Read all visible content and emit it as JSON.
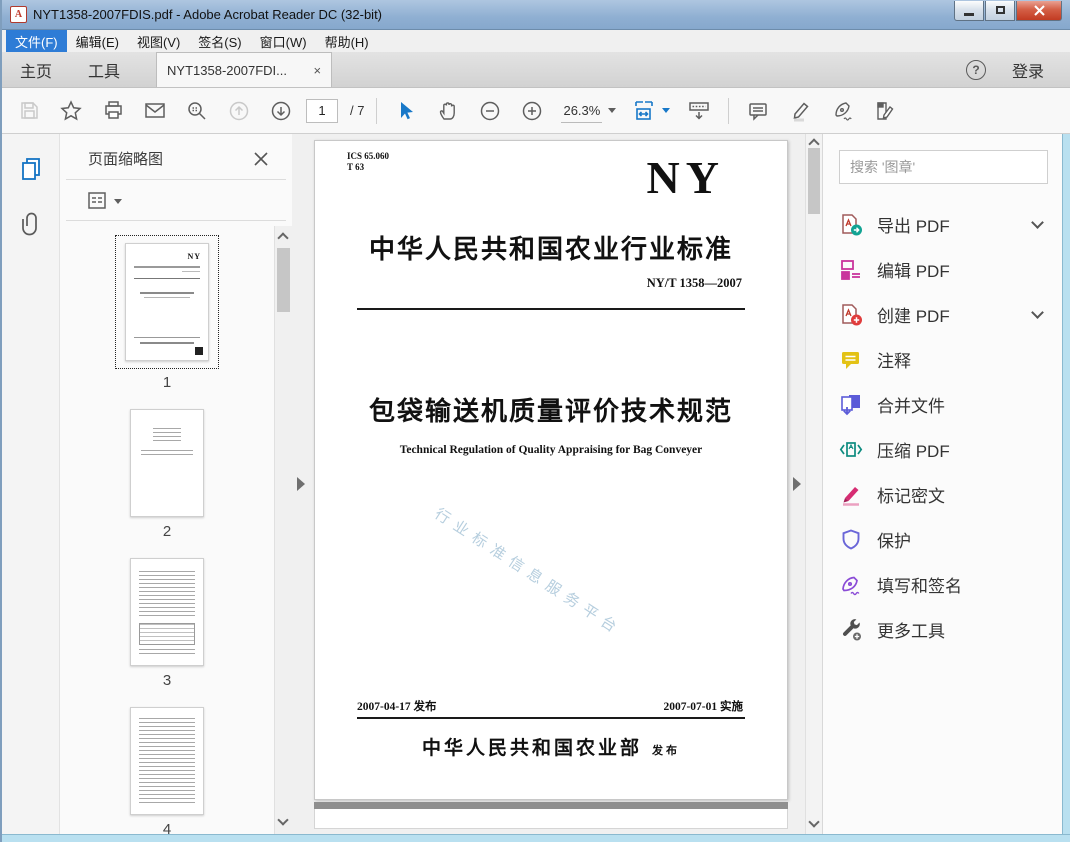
{
  "window": {
    "title": "NYT1358-2007FDIS.pdf - Adobe Acrobat Reader DC (32-bit)",
    "pdf_badge": "A"
  },
  "menu": {
    "items": [
      "文件(F)",
      "编辑(E)",
      "视图(V)",
      "签名(S)",
      "窗口(W)",
      "帮助(H)"
    ]
  },
  "tabs": {
    "home": "主页",
    "tools": "工具",
    "document": "NYT1358-2007FDI...",
    "close": "×"
  },
  "account": {
    "help": "?",
    "login": "登录"
  },
  "toolbar": {
    "page_current": "1",
    "page_total": "/ 7",
    "zoom_level": "26.3%"
  },
  "thumbnail_panel": {
    "title": "页面缩略图",
    "pages": [
      "1",
      "2",
      "3",
      "4"
    ]
  },
  "document": {
    "ics_line1": "ICS 65.060",
    "ics_line2": "T 63",
    "logo": "NY",
    "standard_heading": "中华人民共和国农业行业标准",
    "standard_number": "NY/T 1358—2007",
    "title_cn": "包袋输送机质量评价技术规范",
    "title_en": "Technical Regulation of Quality Appraising for Bag Conveyer",
    "issue_date": "2007-04-17 发布",
    "implement_date": "2007-07-01 实施",
    "publisher": "中华人民共和国农业部",
    "publish_word": "发布",
    "watermark": "行业标准信息服务平台"
  },
  "right_panel": {
    "search_placeholder": "搜索 '图章'",
    "tools": [
      {
        "label": "导出 PDF",
        "icon": "export-pdf-icon",
        "expandable": true
      },
      {
        "label": "编辑 PDF",
        "icon": "edit-pdf-icon",
        "expandable": false
      },
      {
        "label": "创建 PDF",
        "icon": "create-pdf-icon",
        "expandable": true
      },
      {
        "label": "注释",
        "icon": "comment-icon",
        "expandable": false
      },
      {
        "label": "合并文件",
        "icon": "combine-files-icon",
        "expandable": false
      },
      {
        "label": "压缩 PDF",
        "icon": "compress-pdf-icon",
        "expandable": false
      },
      {
        "label": "标记密文",
        "icon": "redact-icon",
        "expandable": false
      },
      {
        "label": "保护",
        "icon": "protect-icon",
        "expandable": false
      },
      {
        "label": "填写和签名",
        "icon": "fill-sign-icon",
        "expandable": false
      },
      {
        "label": "更多工具",
        "icon": "more-tools-icon",
        "expandable": false
      }
    ]
  },
  "colors": {
    "accent_blue": "#1878c8",
    "menu_highlight": "#2e7cd6",
    "close_red": "#c23b22",
    "watermark_blue": "#b6cede"
  }
}
